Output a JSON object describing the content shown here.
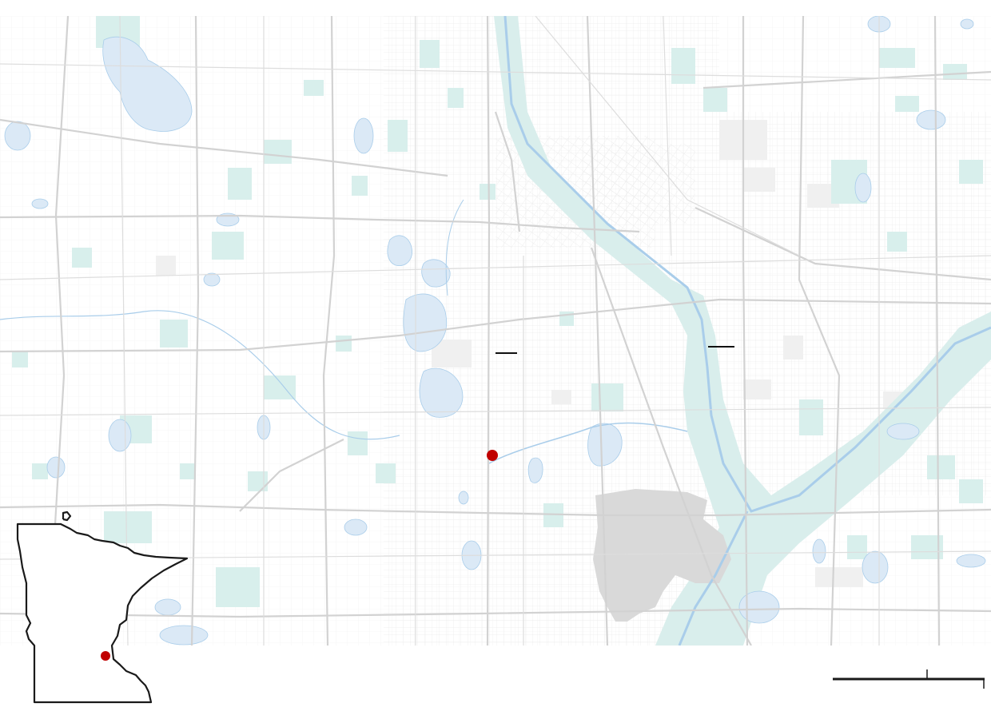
{
  "map": {
    "colors": {
      "background": "#ffffff",
      "street": "#e6e6e6",
      "major_road": "#d2d2d2",
      "water": "#dbe9f6",
      "water_edge": "#a9cdea",
      "park": "#d8efec",
      "airport": "#d9d9d9",
      "block": "#f1f1f1",
      "marker": "#c00000",
      "outline": "#1a1a1a"
    },
    "features": {
      "marker_icon": "red-dot-location-marker",
      "inset_icon": "minnesota-state-outline"
    }
  },
  "inset": {
    "state": "Minnesota"
  },
  "scalebar": {
    "label": ""
  }
}
